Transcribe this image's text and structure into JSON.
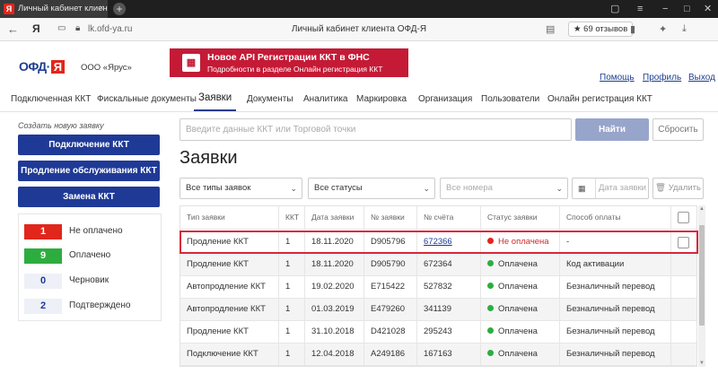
{
  "browser": {
    "tab_title": "Личный кабинет клиента ОФД-Я",
    "tab_favicon": "Я",
    "tab_close": "×",
    "new_tab": "+",
    "back": "←",
    "home_logo": "Я",
    "url": "lk.ofd-ya.ru",
    "page_title": "Личный кабинет клиента ОФД-Я",
    "reviews": "★ 69 отзывов"
  },
  "header": {
    "logo_text": "ОФД·",
    "logo_ya": "Я",
    "org_name": "ООО «Ярус»",
    "banner_title": "Новое API Регистрации ККТ в ФНС",
    "banner_subtitle": "Подробности в разделе Онлайн регистрация ККТ",
    "links": {
      "help": "Помощь",
      "profile": "Профиль",
      "logout": "Выход"
    }
  },
  "nav": {
    "items": [
      "Подключенная ККТ",
      "Фискальные документы",
      "Заявки",
      "Документы",
      "Аналитика",
      "Маркировка",
      "Организация",
      "Пользователи",
      "Онлайн регистрация ККТ"
    ],
    "active_index": 2
  },
  "sidebar": {
    "create_label": "Создать новую заявку",
    "buttons": [
      "Подключение ККТ",
      "Продление обслуживания ККТ",
      "Замена ККТ"
    ],
    "stats": [
      {
        "count": "1",
        "label": "Не оплачено",
        "bg": "#e1261c",
        "fg": "#ffffff"
      },
      {
        "count": "9",
        "label": "Оплачено",
        "bg": "#2dad3f",
        "fg": "#ffffff"
      },
      {
        "count": "0",
        "label": "Черновик",
        "bg": "#edf0f6",
        "fg": "#1f3a96"
      },
      {
        "count": "2",
        "label": "Подтверждено",
        "bg": "#edf0f6",
        "fg": "#1f3a96"
      }
    ]
  },
  "main": {
    "search_placeholder": "Введите данные ККТ или Торговой точки",
    "find_button": "Найти",
    "reset_button": "Сбросить",
    "title": "Заявки",
    "filters": {
      "type": "Все типы заявок",
      "status": "Все статусы",
      "number_placeholder": "Все номера",
      "date_placeholder": "Дата заявки",
      "delete_button": "Удалить"
    },
    "table": {
      "columns": [
        "Тип заявки",
        "ККТ",
        "Дата заявки",
        "№ заявки",
        "№ счёта",
        "Статус заявки",
        "Способ оплаты"
      ],
      "rows": [
        {
          "type": "Продление ККТ",
          "kkt": "1",
          "date": "18.11.2020",
          "num": "D905796",
          "account": "672366",
          "status": "Не оплачена",
          "status_kind": "err",
          "payment": "-"
        },
        {
          "type": "Продление ККТ",
          "kkt": "1",
          "date": "18.11.2020",
          "num": "D905790",
          "account": "672364",
          "status": "Оплачена",
          "status_kind": "ok",
          "payment": "Код активации"
        },
        {
          "type": "Автопродление ККТ",
          "kkt": "1",
          "date": "19.02.2020",
          "num": "E715422",
          "account": "527832",
          "status": "Оплачена",
          "status_kind": "ok",
          "payment": "Безналичный перевод"
        },
        {
          "type": "Автопродление ККТ",
          "kkt": "1",
          "date": "01.03.2019",
          "num": "E479260",
          "account": "341139",
          "status": "Оплачена",
          "status_kind": "ok",
          "payment": "Безналичный перевод"
        },
        {
          "type": "Продление ККТ",
          "kkt": "1",
          "date": "31.10.2018",
          "num": "D421028",
          "account": "295243",
          "status": "Оплачена",
          "status_kind": "ok",
          "payment": "Безналичный перевод"
        },
        {
          "type": "Подключение ККТ",
          "kkt": "1",
          "date": "12.04.2018",
          "num": "A249186",
          "account": "167163",
          "status": "Оплачена",
          "status_kind": "ok",
          "payment": "Безналичный перевод"
        }
      ]
    }
  },
  "icons": {
    "back": "arrow-left-icon",
    "lock": "lock-icon",
    "calendar": "calendar-icon",
    "trash": "trash-icon",
    "chevron": "chevron-down-icon"
  }
}
